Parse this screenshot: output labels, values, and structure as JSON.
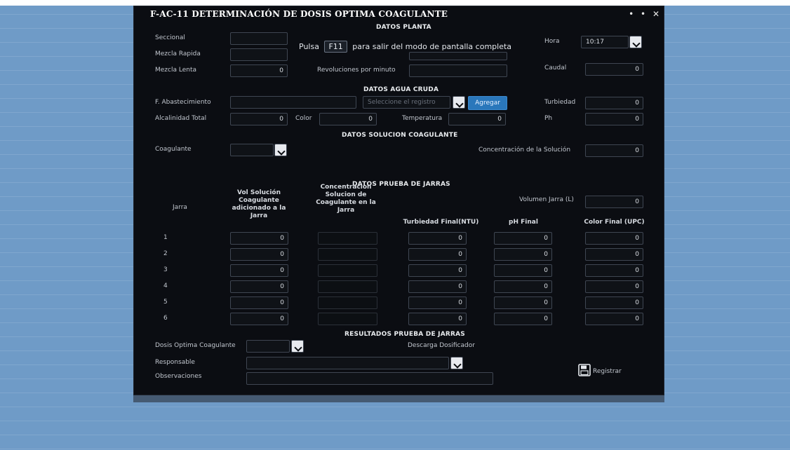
{
  "window": {
    "title": "F-AC-11 DETERMINACIÓN DE DOSIS OPTIMA COAGULANTE",
    "controls": [
      "•",
      "•",
      "✕"
    ]
  },
  "fullscreen_notice": {
    "prefix": "Pulsa",
    "key": "F11",
    "suffix": "para salir del modo de pantalla completa"
  },
  "datos_planta": {
    "title": "DATOS PLANTA",
    "seccional_label": "Seccional",
    "mezcla_rapida_label": "Mezcla Rapida",
    "mezcla_lenta_label": "Mezcla Lenta",
    "mezcla_lenta_value": "0",
    "revoluciones_label": "Revoluciones por minuto",
    "hora_label": "Hora",
    "hora_value": "10:17",
    "caudal_label": "Caudal",
    "caudal_value": "0"
  },
  "datos_agua": {
    "title": "DATOS AGUA CRUDA",
    "abastecimiento_label": "F. Abastecimiento",
    "seleccione_placeholder": "Seleccione el registro",
    "agregar_label": "Agregar",
    "turbiedad_label": "Turbiedad",
    "turbiedad_value": "0",
    "alcalinidad_label": "Alcalinidad Total",
    "alcalinidad_value": "0",
    "color_label": "Color",
    "color_value": "0",
    "temperatura_label": "Temperatura",
    "temperatura_value": "0",
    "ph_label": "Ph",
    "ph_value": "0"
  },
  "datos_solucion": {
    "title": "DATOS SOLUCION COAGULANTE",
    "coagulante_label": "Coagulante",
    "concentracion_label": "Concentración de la Solución",
    "concentracion_value": "0"
  },
  "datos_prueba": {
    "title": "DATOS PRUEBA DE JARRAS",
    "volumen_label": "Volumen Jarra (L)",
    "volumen_value": "0",
    "columns": {
      "jarra": "Jarra",
      "vol_solucion": "Vol Solución Coagulante adicionado a la Jarra",
      "concentracion": "Concentracion Solucion de Coagulante en la Jarra",
      "turbiedad_final": "Turbiedad Final(NTU)",
      "ph_final": "pH Final",
      "color_final": "Color Final (UPC)"
    },
    "rows": [
      {
        "n": "1",
        "vol": "0",
        "turb": "0",
        "ph": "0",
        "color": "0"
      },
      {
        "n": "2",
        "vol": "0",
        "turb": "0",
        "ph": "0",
        "color": "0"
      },
      {
        "n": "3",
        "vol": "0",
        "turb": "0",
        "ph": "0",
        "color": "0"
      },
      {
        "n": "4",
        "vol": "0",
        "turb": "0",
        "ph": "0",
        "color": "0"
      },
      {
        "n": "5",
        "vol": "0",
        "turb": "0",
        "ph": "0",
        "color": "0"
      },
      {
        "n": "6",
        "vol": "0",
        "turb": "0",
        "ph": "0",
        "color": "0"
      }
    ]
  },
  "resultados": {
    "title": "RESULTADOS PRUEBA DE JARRAS",
    "dosis_label": "Dosis Optima Coagulante",
    "descarga_label": "Descarga Dosificador",
    "responsable_label": "Responsable",
    "observaciones_label": "Observaciones",
    "registrar_label": "Registrar"
  },
  "colors": {
    "app_bg": "#0b0d12",
    "accent": "#2a77bb",
    "field_border": "#3f4652",
    "desktop": "#6f9bc7"
  },
  "icons": {
    "save": "floppy-disk-icon",
    "dropdown": "chevron-down-icon"
  }
}
